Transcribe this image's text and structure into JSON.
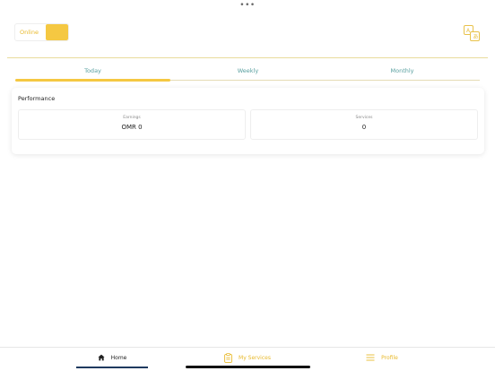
{
  "top_indicator": "•••",
  "status": {
    "label": "Online",
    "accent_color": "#f5c842"
  },
  "header": {
    "translate_icon": "translate-icon"
  },
  "tabs": {
    "items": [
      {
        "label": "Today",
        "selected": true
      },
      {
        "label": "Weekly",
        "selected": false
      },
      {
        "label": "Monthly",
        "selected": false
      }
    ],
    "indicator_color": "#f5c842",
    "label_color": "#5aa0a0"
  },
  "performance": {
    "title": "Performance",
    "earnings": {
      "label": "Earnings",
      "value": "OMR 0"
    },
    "services": {
      "label": "Services",
      "value": "0"
    }
  },
  "bottom_nav": {
    "items": [
      {
        "label": "Home",
        "icon": "home-icon",
        "active": true
      },
      {
        "label": "My Services",
        "icon": "clipboard-icon",
        "active": false
      },
      {
        "label": "Profile",
        "icon": "menu-icon",
        "active": false
      }
    ],
    "active_color": "#1f3a5f",
    "inactive_color": "#e8b92b"
  }
}
